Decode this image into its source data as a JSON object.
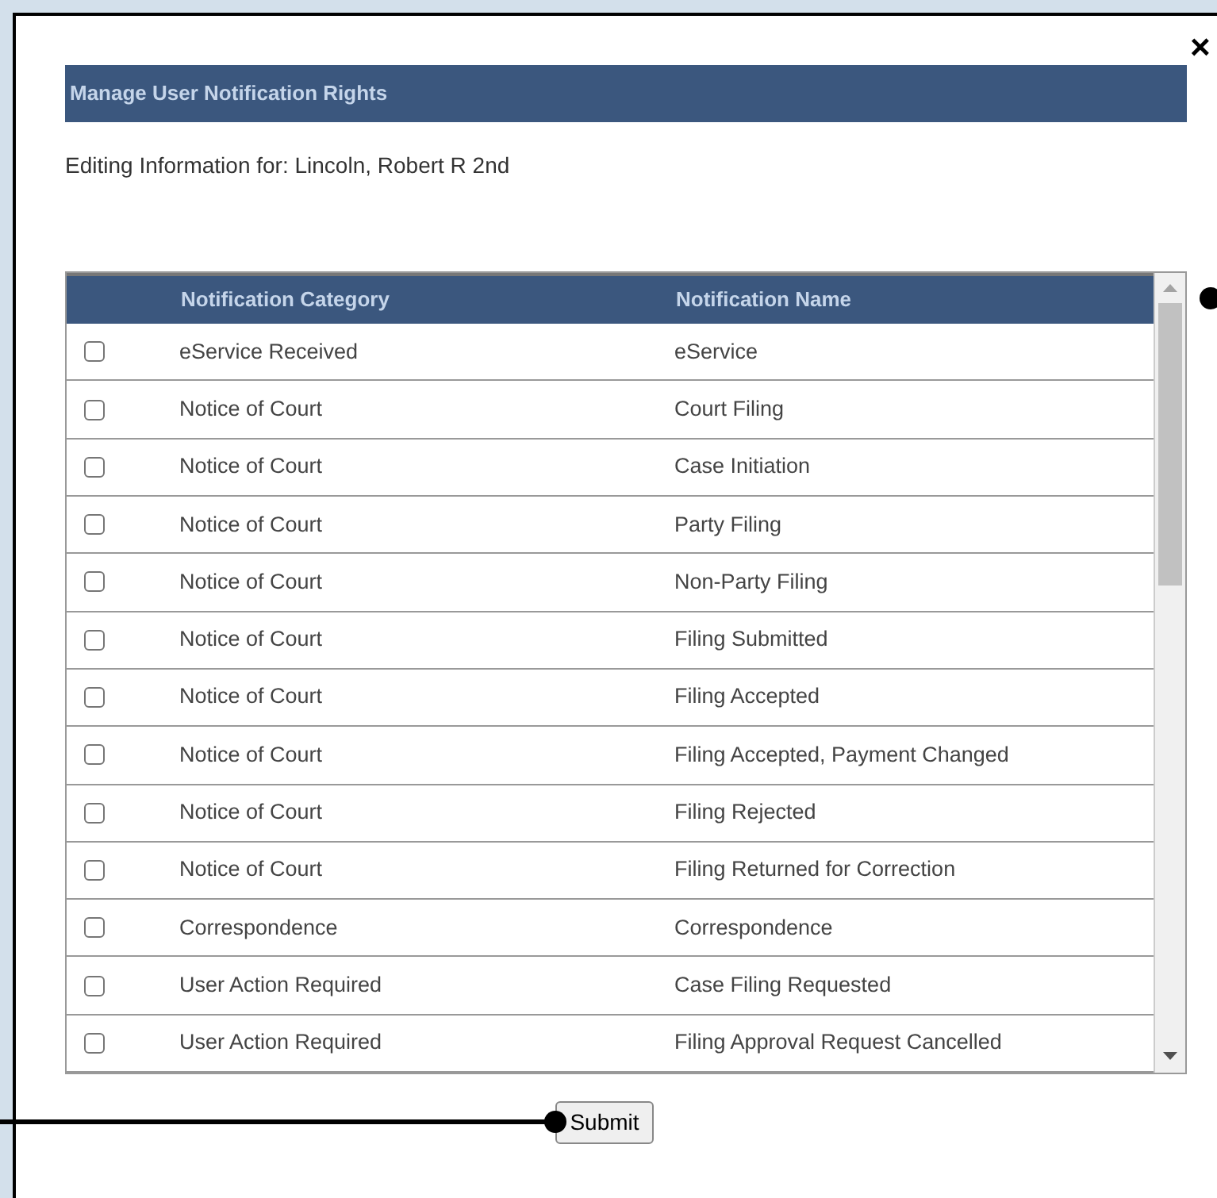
{
  "dialog": {
    "close": "×",
    "title": "Manage User Notification Rights",
    "subtitle": "Editing Information for: Lincoln, Robert R 2nd"
  },
  "table": {
    "columns": [
      "Notification Category",
      "Notification Name"
    ],
    "rows": [
      {
        "category": "eService Received",
        "name": "eService",
        "checked": false
      },
      {
        "category": "Notice of Court",
        "name": "Court Filing",
        "checked": false
      },
      {
        "category": "Notice of Court",
        "name": "Case Initiation",
        "checked": false
      },
      {
        "category": "Notice of Court",
        "name": "Party Filing",
        "checked": false
      },
      {
        "category": "Notice of Court",
        "name": "Non-Party Filing",
        "checked": false
      },
      {
        "category": "Notice of Court",
        "name": "Filing Submitted",
        "checked": false
      },
      {
        "category": "Notice of Court",
        "name": "Filing Accepted",
        "checked": false
      },
      {
        "category": "Notice of Court",
        "name": "Filing Accepted, Payment Changed",
        "checked": false
      },
      {
        "category": "Notice of Court",
        "name": "Filing Rejected",
        "checked": false
      },
      {
        "category": "Notice of Court",
        "name": "Filing Returned for Correction",
        "checked": false
      },
      {
        "category": "Correspondence",
        "name": "Correspondence",
        "checked": false
      },
      {
        "category": "User Action Required",
        "name": "Case Filing Requested",
        "checked": false
      },
      {
        "category": "User Action Required",
        "name": "Filing Approval Request Cancelled",
        "checked": false
      }
    ]
  },
  "submit": "Submit"
}
